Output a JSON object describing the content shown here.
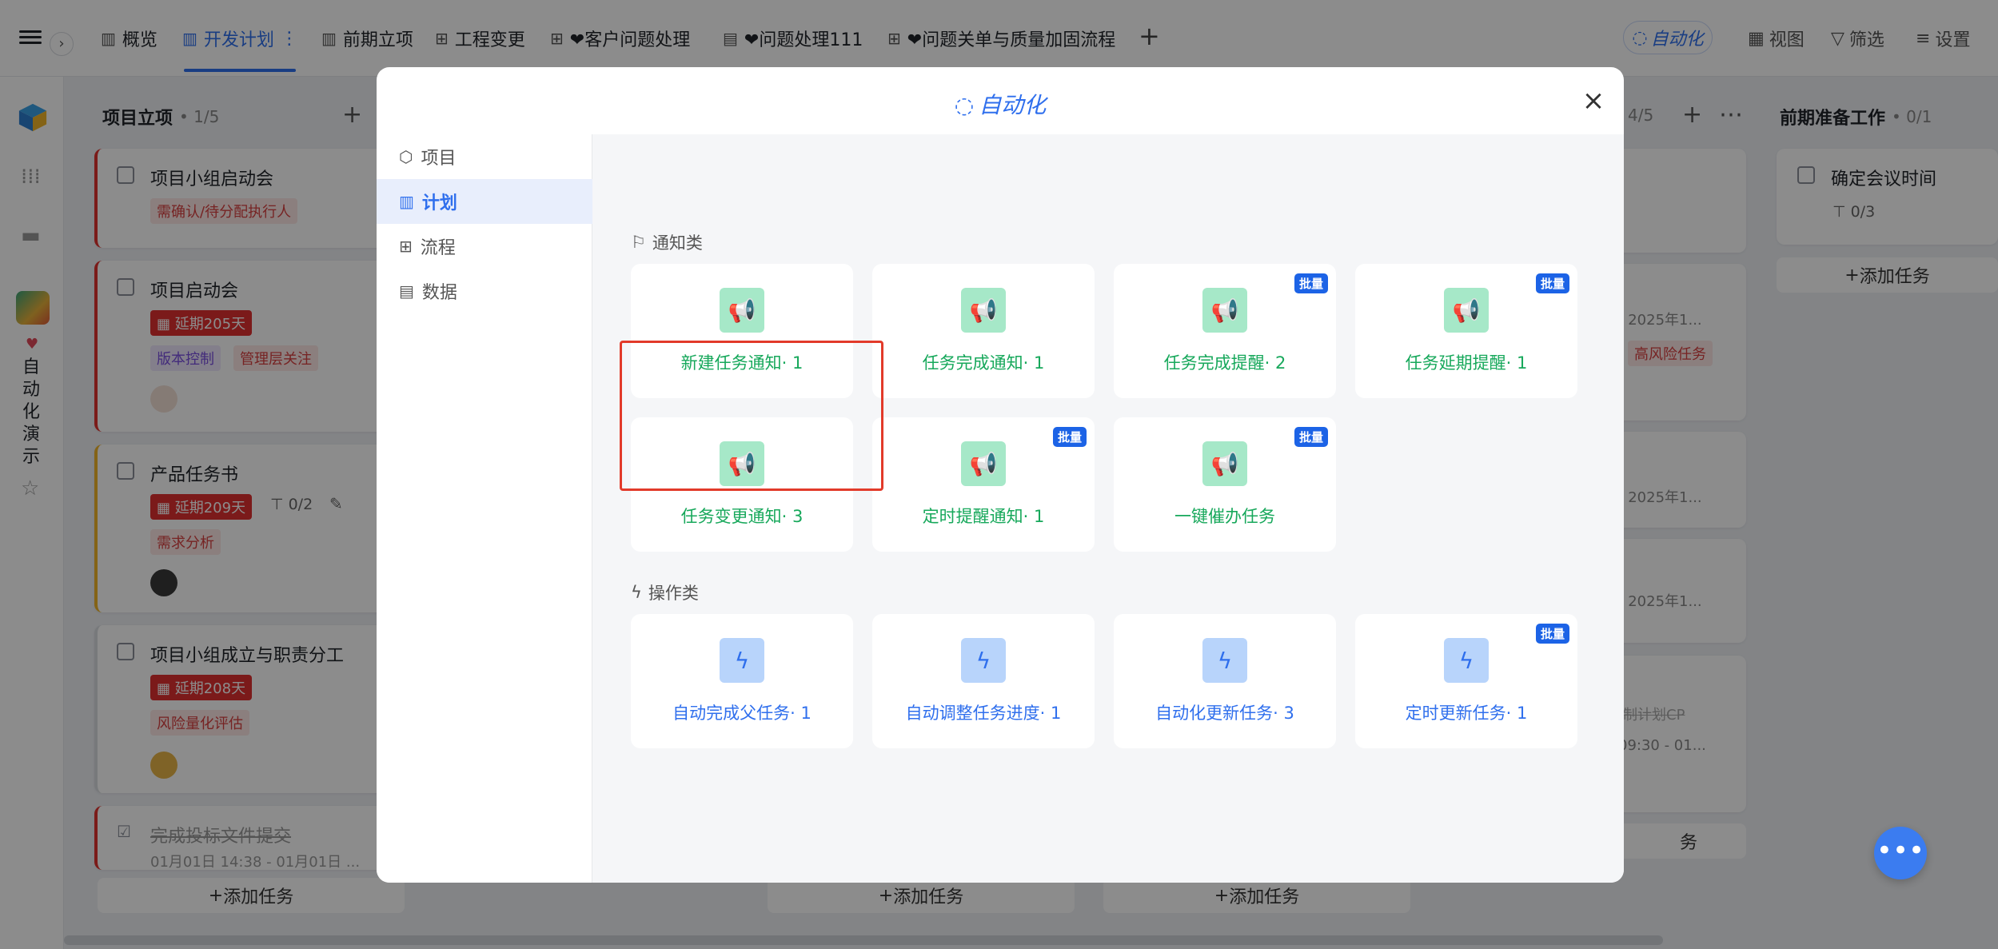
{
  "topbar": {
    "tabs": [
      {
        "label": "概览",
        "icon": "overview-icon"
      },
      {
        "label": "开发计划",
        "icon": "plan-icon",
        "more": "⋮"
      },
      {
        "label": "前期立项",
        "icon": "plan-icon"
      },
      {
        "label": "工程变更",
        "icon": "flow-icon"
      },
      {
        "label": "❤客户问题处理",
        "icon": "flow-icon"
      },
      {
        "label": "❤问题处理111",
        "icon": "doc-icon"
      },
      {
        "label": "❤问题关单与质量加固流程",
        "icon": "flow-icon"
      }
    ],
    "add_tab": "+",
    "automation": "自动化",
    "view": "视图",
    "filter": "筛选",
    "settings": "设置"
  },
  "sidebar": {
    "app_name": "自动化演示",
    "heart": "♥"
  },
  "board": {
    "col1": {
      "title": "项目立项",
      "count": "• 1/5",
      "cards": [
        {
          "title": "项目小组启动会",
          "tag": "需确认/待分配执行人"
        },
        {
          "title": "项目启动会",
          "delay": "延期205天",
          "tags": [
            "版本控制",
            "管理层关注"
          ]
        },
        {
          "title": "产品任务书",
          "delay": "延期209天",
          "sub": "0/2",
          "tag": "需求分析"
        },
        {
          "title": "项目小组成立与职责分工",
          "delay": "延期208天",
          "tag": "风险量化评估"
        },
        {
          "title": "完成投标文件提交",
          "date": "01月01日 14:38 - 01月01日 ..."
        }
      ],
      "add": "添加任务"
    },
    "col3_count": "4/5",
    "col3_snippets": [
      "- 2025年1...",
      "高风险任务",
      "- 2025年1...",
      "- 2025年1...",
      "制计划CP",
      "09:30 - 01...",
      "务"
    ],
    "col4": {
      "title": "前期准备工作",
      "count": "• 0/1",
      "card": "确定会议时间",
      "sub": "0/3",
      "add": "添加任务"
    },
    "add_task": "添加任务"
  },
  "modal": {
    "title": "自动化",
    "nav": [
      {
        "label": "项目",
        "icon": "project-icon"
      },
      {
        "label": "计划",
        "icon": "plan-icon",
        "active": true
      },
      {
        "label": "流程",
        "icon": "flow-icon"
      },
      {
        "label": "数据",
        "icon": "data-icon"
      }
    ],
    "notify_section": "通知类",
    "notify": [
      {
        "label": "新建任务通知· 1",
        "badge": ""
      },
      {
        "label": "任务完成通知· 1",
        "badge": ""
      },
      {
        "label": "任务完成提醒· 2",
        "badge": "批量"
      },
      {
        "label": "任务延期提醒· 1",
        "badge": "批量"
      },
      {
        "label": "任务变更通知· 3",
        "badge": ""
      },
      {
        "label": "定时提醒通知· 1",
        "badge": "批量"
      },
      {
        "label": "一键催办任务",
        "badge": "批量"
      }
    ],
    "action_section": "操作类",
    "action": [
      {
        "label": "自动完成父任务· 1",
        "badge": ""
      },
      {
        "label": "自动调整任务进度· 1",
        "badge": ""
      },
      {
        "label": "自动化更新任务· 3",
        "badge": ""
      },
      {
        "label": "定时更新任务· 1",
        "badge": "批量"
      }
    ]
  },
  "fab": "•••"
}
